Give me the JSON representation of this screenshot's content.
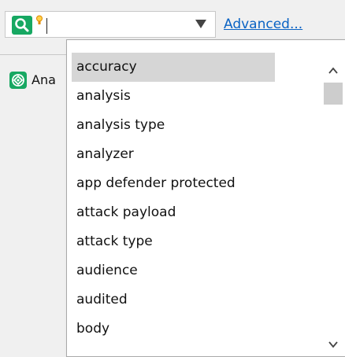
{
  "search": {
    "value": "",
    "link_label": "Advanced..."
  },
  "panel": {
    "label": "Ana",
    "icon": "target-icon"
  },
  "suggestions": {
    "selected_index": 0,
    "items": [
      "accuracy",
      "analysis",
      "analysis type",
      "analyzer",
      "app defender protected",
      "attack payload",
      "attack type",
      "audience",
      "audited",
      "body"
    ]
  },
  "colors": {
    "accent_green": "#17a862",
    "link_blue": "#0a63c4",
    "selection_gray": "#d6d6d6"
  }
}
